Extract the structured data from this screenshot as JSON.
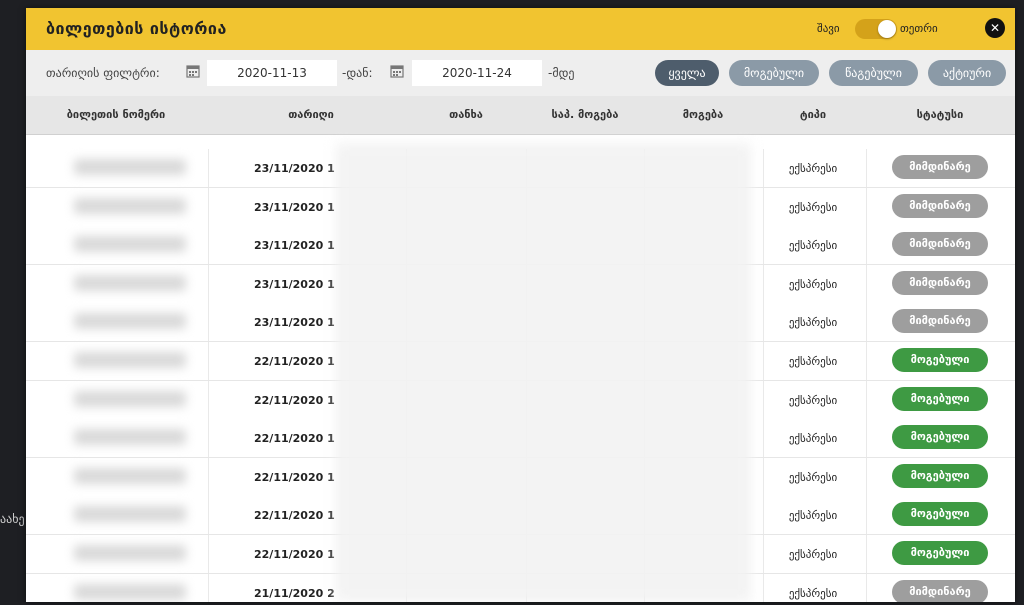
{
  "modal": {
    "title": "ბილეთების ისტორია",
    "theme_dark": "შავი",
    "theme_light": "თეთრი",
    "close": "✕"
  },
  "filter": {
    "label": "თარიღის ფილტრი:",
    "from_value": "2020-11-13",
    "from_suffix": "-დან:",
    "to_value": "2020-11-24",
    "to_suffix": "-მდე",
    "buttons": [
      "ყველა",
      "მოგებული",
      "წაგებული",
      "აქტიური"
    ]
  },
  "columns": [
    "ბილეთის ნომერი",
    "თარიღი",
    "თანხა",
    "საპ. მოგება",
    "მოგება",
    "ტიპი",
    "სტატუსი"
  ],
  "rows": [
    {
      "date": "23/11/2020 1",
      "type": "ექსპრესი",
      "status": "მიმდინარე",
      "status_kind": "gray"
    },
    {
      "date": "23/11/2020 1",
      "type": "ექსპრესი",
      "status": "მიმდინარე",
      "status_kind": "gray"
    },
    {
      "date": "23/11/2020 1",
      "type": "ექსპრესი",
      "status": "მიმდინარე",
      "status_kind": "gray"
    },
    {
      "date": "23/11/2020 1",
      "type": "ექსპრესი",
      "status": "მიმდინარე",
      "status_kind": "gray"
    },
    {
      "date": "23/11/2020 1",
      "type": "ექსპრესი",
      "status": "მიმდინარე",
      "status_kind": "gray"
    },
    {
      "date": "22/11/2020 1",
      "type": "ექსპრესი",
      "status": "მოგებული",
      "status_kind": "green"
    },
    {
      "date": "22/11/2020 1",
      "type": "ექსპრესი",
      "status": "მოგებული",
      "status_kind": "green"
    },
    {
      "date": "22/11/2020 1",
      "type": "ექსპრესი",
      "status": "მოგებული",
      "status_kind": "green"
    },
    {
      "date": "22/11/2020 1",
      "type": "ექსპრესი",
      "status": "მოგებული",
      "status_kind": "green"
    },
    {
      "date": "22/11/2020 1",
      "type": "ექსპრესი",
      "status": "მოგებული",
      "status_kind": "green"
    },
    {
      "date": "22/11/2020 1",
      "type": "ექსპრესი",
      "status": "მოგებული",
      "status_kind": "green"
    },
    {
      "date": "21/11/2020 2",
      "type": "ექსპრესი",
      "status": "მიმდინარე",
      "status_kind": "gray"
    }
  ],
  "colors": {
    "header": "#f1c430",
    "chip_active": "#4e5d6c",
    "chip_inactive": "#8b9aa7",
    "status_gray": "#9e9e9e",
    "status_green": "#3e9a43"
  },
  "background": {
    "left_text": "აახე"
  }
}
